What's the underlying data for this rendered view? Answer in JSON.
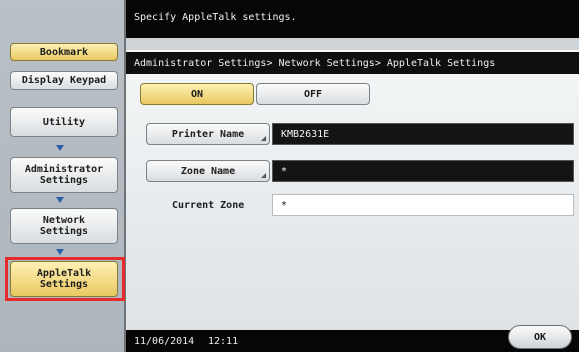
{
  "header": {
    "message": "Specify AppleTalk settings."
  },
  "sidebar": {
    "bookmark_label": "Bookmark",
    "display_keypad_label": "Display Keypad",
    "nav": [
      {
        "label": "Utility"
      },
      {
        "label": "Administrator\nSettings"
      },
      {
        "label": "Network\nSettings"
      },
      {
        "label": "AppleTalk\nSettings"
      }
    ]
  },
  "breadcrumb": "Administrator Settings> Network Settings> AppleTalk Settings",
  "toggle": {
    "on_label": "ON",
    "off_label": "OFF",
    "selected": "ON"
  },
  "fields": {
    "printer_name": {
      "label": "Printer Name",
      "value": "KMB2631E"
    },
    "zone_name": {
      "label": "Zone Name",
      "value": "*"
    },
    "current_zone": {
      "label": "Current Zone",
      "value": "*"
    }
  },
  "footer": {
    "date": "11/06/2014",
    "time": "12:11",
    "ok_label": "OK"
  },
  "colors": {
    "selected": "#e8c860",
    "highlight": "#e52b2b"
  }
}
